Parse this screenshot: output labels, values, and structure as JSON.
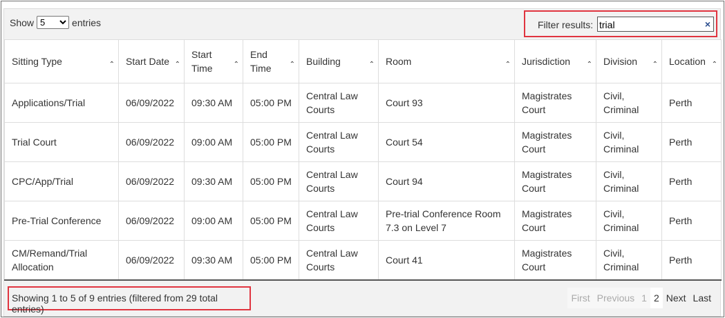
{
  "length_menu": {
    "show_label": "Show",
    "entries_label": "entries",
    "selected": "5"
  },
  "filter": {
    "label": "Filter results:",
    "value": "trial",
    "clear_icon": "×"
  },
  "columns": [
    {
      "label": "Sitting Type",
      "width": 165
    },
    {
      "label": "Start Date",
      "width": 95
    },
    {
      "label": "Start Time",
      "width": 85
    },
    {
      "label": "End Time",
      "width": 81
    },
    {
      "label": "Building",
      "width": 115
    },
    {
      "label": "Room",
      "width": 197
    },
    {
      "label": "Jurisdiction",
      "width": 118
    },
    {
      "label": "Division",
      "width": 95
    },
    {
      "label": "Location",
      "width": 86
    }
  ],
  "rows": [
    [
      "Applications/Trial",
      "06/09/2022",
      "09:30 AM",
      "05:00 PM",
      "Central Law Courts",
      "Court 93",
      "Magistrates Court",
      "Civil, Criminal",
      "Perth"
    ],
    [
      "Trial Court",
      "06/09/2022",
      "09:00 AM",
      "05:00 PM",
      "Central Law Courts",
      "Court 54",
      "Magistrates Court",
      "Civil, Criminal",
      "Perth"
    ],
    [
      "CPC/App/Trial",
      "06/09/2022",
      "09:30 AM",
      "05:00 PM",
      "Central Law Courts",
      "Court 94",
      "Magistrates Court",
      "Civil, Criminal",
      "Perth"
    ],
    [
      "Pre-Trial Conference",
      "06/09/2022",
      "09:00 AM",
      "05:00 PM",
      "Central Law Courts",
      "Pre-trial Conference Room 7.3 on Level 7",
      "Magistrates Court",
      "Civil, Criminal",
      "Perth"
    ],
    [
      "CM/Remand/Trial Allocation",
      "06/09/2022",
      "09:30 AM",
      "05:00 PM",
      "Central Law Courts",
      "Court 41",
      "Magistrates Court",
      "Civil, Criminal",
      "Perth"
    ]
  ],
  "info": "Showing 1 to 5 of 9 entries (filtered from 29 total entries)",
  "pagination": {
    "first": "First",
    "previous": "Previous",
    "page1": "1",
    "page2": "2",
    "next": "Next",
    "last": "Last"
  },
  "colors": {
    "highlight": "#e0343f",
    "clear_icon": "#2a4d8e"
  }
}
